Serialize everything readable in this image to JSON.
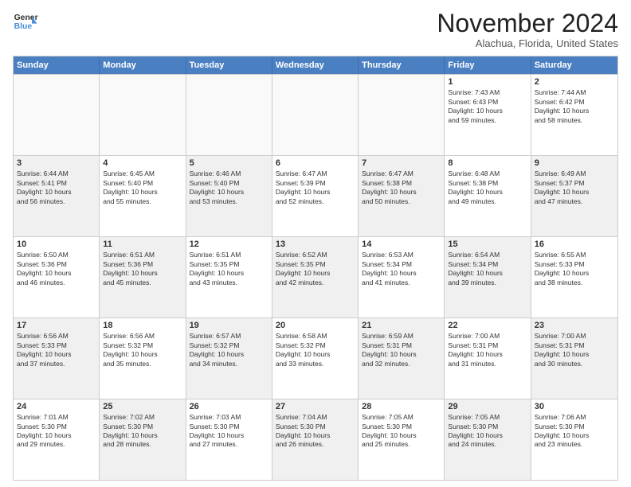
{
  "logo": {
    "line1": "General",
    "line2": "Blue"
  },
  "title": "November 2024",
  "location": "Alachua, Florida, United States",
  "weekdays": [
    "Sunday",
    "Monday",
    "Tuesday",
    "Wednesday",
    "Thursday",
    "Friday",
    "Saturday"
  ],
  "weeks": [
    [
      {
        "day": "",
        "empty": true
      },
      {
        "day": "",
        "empty": true
      },
      {
        "day": "",
        "empty": true
      },
      {
        "day": "",
        "empty": true
      },
      {
        "day": "",
        "empty": true
      },
      {
        "day": "1",
        "lines": [
          "Sunrise: 7:43 AM",
          "Sunset: 6:43 PM",
          "Daylight: 10 hours",
          "and 59 minutes."
        ]
      },
      {
        "day": "2",
        "lines": [
          "Sunrise: 7:44 AM",
          "Sunset: 6:42 PM",
          "Daylight: 10 hours",
          "and 58 minutes."
        ]
      }
    ],
    [
      {
        "day": "3",
        "shaded": true,
        "lines": [
          "Sunrise: 6:44 AM",
          "Sunset: 5:41 PM",
          "Daylight: 10 hours",
          "and 56 minutes."
        ]
      },
      {
        "day": "4",
        "lines": [
          "Sunrise: 6:45 AM",
          "Sunset: 5:40 PM",
          "Daylight: 10 hours",
          "and 55 minutes."
        ]
      },
      {
        "day": "5",
        "shaded": true,
        "lines": [
          "Sunrise: 6:46 AM",
          "Sunset: 5:40 PM",
          "Daylight: 10 hours",
          "and 53 minutes."
        ]
      },
      {
        "day": "6",
        "lines": [
          "Sunrise: 6:47 AM",
          "Sunset: 5:39 PM",
          "Daylight: 10 hours",
          "and 52 minutes."
        ]
      },
      {
        "day": "7",
        "shaded": true,
        "lines": [
          "Sunrise: 6:47 AM",
          "Sunset: 5:38 PM",
          "Daylight: 10 hours",
          "and 50 minutes."
        ]
      },
      {
        "day": "8",
        "lines": [
          "Sunrise: 6:48 AM",
          "Sunset: 5:38 PM",
          "Daylight: 10 hours",
          "and 49 minutes."
        ]
      },
      {
        "day": "9",
        "shaded": true,
        "lines": [
          "Sunrise: 6:49 AM",
          "Sunset: 5:37 PM",
          "Daylight: 10 hours",
          "and 47 minutes."
        ]
      }
    ],
    [
      {
        "day": "10",
        "lines": [
          "Sunrise: 6:50 AM",
          "Sunset: 5:36 PM",
          "Daylight: 10 hours",
          "and 46 minutes."
        ]
      },
      {
        "day": "11",
        "shaded": true,
        "lines": [
          "Sunrise: 6:51 AM",
          "Sunset: 5:36 PM",
          "Daylight: 10 hours",
          "and 45 minutes."
        ]
      },
      {
        "day": "12",
        "lines": [
          "Sunrise: 6:51 AM",
          "Sunset: 5:35 PM",
          "Daylight: 10 hours",
          "and 43 minutes."
        ]
      },
      {
        "day": "13",
        "shaded": true,
        "lines": [
          "Sunrise: 6:52 AM",
          "Sunset: 5:35 PM",
          "Daylight: 10 hours",
          "and 42 minutes."
        ]
      },
      {
        "day": "14",
        "lines": [
          "Sunrise: 6:53 AM",
          "Sunset: 5:34 PM",
          "Daylight: 10 hours",
          "and 41 minutes."
        ]
      },
      {
        "day": "15",
        "shaded": true,
        "lines": [
          "Sunrise: 6:54 AM",
          "Sunset: 5:34 PM",
          "Daylight: 10 hours",
          "and 39 minutes."
        ]
      },
      {
        "day": "16",
        "lines": [
          "Sunrise: 6:55 AM",
          "Sunset: 5:33 PM",
          "Daylight: 10 hours",
          "and 38 minutes."
        ]
      }
    ],
    [
      {
        "day": "17",
        "shaded": true,
        "lines": [
          "Sunrise: 6:56 AM",
          "Sunset: 5:33 PM",
          "Daylight: 10 hours",
          "and 37 minutes."
        ]
      },
      {
        "day": "18",
        "lines": [
          "Sunrise: 6:56 AM",
          "Sunset: 5:32 PM",
          "Daylight: 10 hours",
          "and 35 minutes."
        ]
      },
      {
        "day": "19",
        "shaded": true,
        "lines": [
          "Sunrise: 6:57 AM",
          "Sunset: 5:32 PM",
          "Daylight: 10 hours",
          "and 34 minutes."
        ]
      },
      {
        "day": "20",
        "lines": [
          "Sunrise: 6:58 AM",
          "Sunset: 5:32 PM",
          "Daylight: 10 hours",
          "and 33 minutes."
        ]
      },
      {
        "day": "21",
        "shaded": true,
        "lines": [
          "Sunrise: 6:59 AM",
          "Sunset: 5:31 PM",
          "Daylight: 10 hours",
          "and 32 minutes."
        ]
      },
      {
        "day": "22",
        "lines": [
          "Sunrise: 7:00 AM",
          "Sunset: 5:31 PM",
          "Daylight: 10 hours",
          "and 31 minutes."
        ]
      },
      {
        "day": "23",
        "shaded": true,
        "lines": [
          "Sunrise: 7:00 AM",
          "Sunset: 5:31 PM",
          "Daylight: 10 hours",
          "and 30 minutes."
        ]
      }
    ],
    [
      {
        "day": "24",
        "lines": [
          "Sunrise: 7:01 AM",
          "Sunset: 5:30 PM",
          "Daylight: 10 hours",
          "and 29 minutes."
        ]
      },
      {
        "day": "25",
        "shaded": true,
        "lines": [
          "Sunrise: 7:02 AM",
          "Sunset: 5:30 PM",
          "Daylight: 10 hours",
          "and 28 minutes."
        ]
      },
      {
        "day": "26",
        "lines": [
          "Sunrise: 7:03 AM",
          "Sunset: 5:30 PM",
          "Daylight: 10 hours",
          "and 27 minutes."
        ]
      },
      {
        "day": "27",
        "shaded": true,
        "lines": [
          "Sunrise: 7:04 AM",
          "Sunset: 5:30 PM",
          "Daylight: 10 hours",
          "and 26 minutes."
        ]
      },
      {
        "day": "28",
        "lines": [
          "Sunrise: 7:05 AM",
          "Sunset: 5:30 PM",
          "Daylight: 10 hours",
          "and 25 minutes."
        ]
      },
      {
        "day": "29",
        "shaded": true,
        "lines": [
          "Sunrise: 7:05 AM",
          "Sunset: 5:30 PM",
          "Daylight: 10 hours",
          "and 24 minutes."
        ]
      },
      {
        "day": "30",
        "lines": [
          "Sunrise: 7:06 AM",
          "Sunset: 5:30 PM",
          "Daylight: 10 hours",
          "and 23 minutes."
        ]
      }
    ]
  ]
}
